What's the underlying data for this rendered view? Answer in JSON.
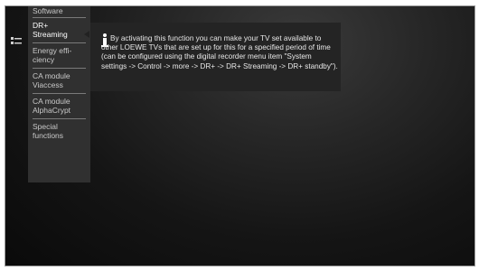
{
  "menu": {
    "items": [
      {
        "label": "Software"
      },
      {
        "label": "DR+\nStreaming",
        "selected": true
      },
      {
        "label": "Energy effi-\nciency"
      },
      {
        "label": "CA module\nViaccess"
      },
      {
        "label": "CA module\nAlphaCrypt"
      },
      {
        "label": "Special\nfunctions"
      }
    ]
  },
  "info": {
    "text": "By activating this function you can make your TV set available to other LOEWE TVs that are set up for this for a specified period of time (can be configured using the digital recorder menu item \"System settings -> Control -> more -> DR+ -> DR+ Streaming -> DR+ standby\")."
  },
  "colors": {
    "menu_background": "#303030",
    "info_background": "#242424",
    "text": "#e8e8e8"
  },
  "icons": {
    "menu_glyph": "menu-list-icon",
    "info": "info-icon"
  }
}
